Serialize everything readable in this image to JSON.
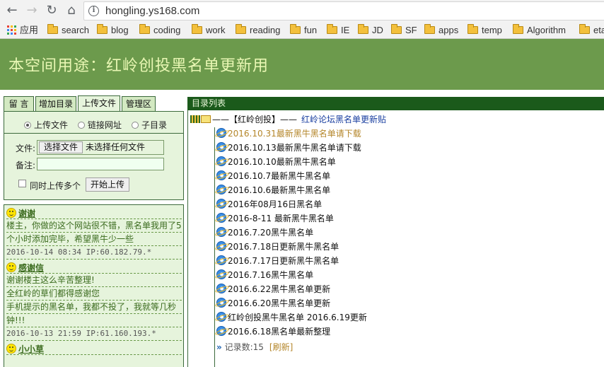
{
  "browser": {
    "url": "hongling.ys168.com",
    "bookmarks": [
      "应用",
      "search",
      "blog",
      "coding",
      "work",
      "reading",
      "fun",
      "IE",
      "JD",
      "SF",
      "apps",
      "temp",
      "Algorithm",
      "eta"
    ]
  },
  "banner": {
    "title": "本空间用途：红岭创投黑名单更新用"
  },
  "tabs": [
    "留 言",
    "增加目录",
    "上传文件",
    "管理区"
  ],
  "upload": {
    "radio_options": [
      "上传文件",
      "链接网址",
      "子目录"
    ],
    "file_label": "文件:",
    "file_button": "选择文件",
    "file_status": "未选择任何文件",
    "note_label": "备注:",
    "multi_label": "同时上传多个",
    "start_button": "开始上传"
  },
  "messages": [
    {
      "name": "谢谢",
      "lines": [
        "楼主，你做的这个网站很不错，黑名单我用了5",
        "个小时添加完毕，希望黑牛少一些"
      ],
      "meta": "2016-10-14 08:34 IP:60.182.79.*"
    },
    {
      "name": "感谢信",
      "lines": [
        "谢谢楼主这么辛苦整理!",
        "全红岭的草们都得感谢您",
        "手机提示的黑名单，我都不投了，我就等几秒",
        "钟!!!"
      ],
      "meta": "2016-10-13 21:59 IP:61.160.193.*"
    },
    {
      "name": "小小草",
      "lines": [],
      "meta": ""
    }
  ],
  "directory": {
    "header": "目录列表",
    "category": "——【红岭创投】——",
    "category_link": "红岭论坛黑名单更新贴",
    "items": [
      "2016.10.31最新黑牛黑名单请下载",
      "2016.10.13最新黑牛黑名单请下载",
      "2016.10.10最新黑牛黑名单",
      "2016.10.7最新黑牛黑名单",
      "2016.10.6最新黑牛黑名单",
      "2016年08月16日黑名单",
      "2016-8-11 最新黑牛黑名单",
      "2016.7.20黑牛黑名单",
      "2016.7.18日更新黑牛黑名单",
      "2016.7.17日更新黑牛黑名单",
      "2016.7.16黑牛黑名单",
      "2016.6.22黑牛黑名单更新",
      "2016.6.20黑牛黑名单更新",
      "红岭创投黑牛黑名单 2016.6.19更新",
      "2016.6.18黑名单最新整理"
    ],
    "count_label": "记录数:15",
    "refresh_label": "[刷新]"
  }
}
